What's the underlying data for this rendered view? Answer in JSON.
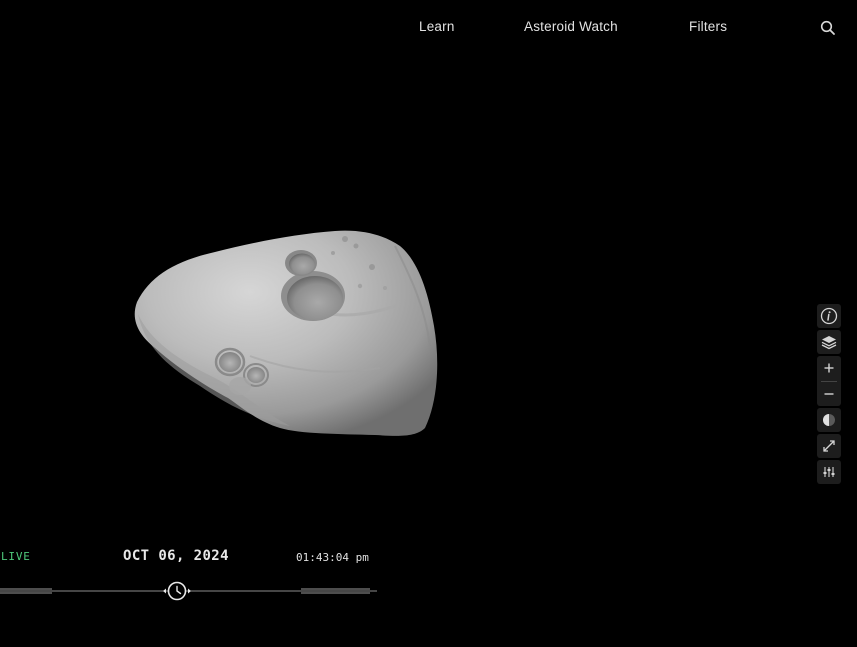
{
  "nav": {
    "items": [
      {
        "label": "Learn"
      },
      {
        "label": "Asteroid Watch"
      },
      {
        "label": "Filters"
      }
    ],
    "search_icon": "search-icon"
  },
  "viewer": {
    "object_icon": "asteroid-3d-model",
    "body_color": "#bdbdbd"
  },
  "controls": {
    "icons": [
      "info-icon",
      "layers-icon",
      "zoom-in-icon",
      "zoom-out-icon",
      "contrast-icon",
      "fullscreen-icon",
      "settings-sliders-icon"
    ]
  },
  "timeline": {
    "live_label": "LIVE",
    "date": "OCT 06, 2024",
    "time": "01:43:04 pm",
    "live_color": "#4fc97b",
    "handle_icon": "clock-icon"
  }
}
